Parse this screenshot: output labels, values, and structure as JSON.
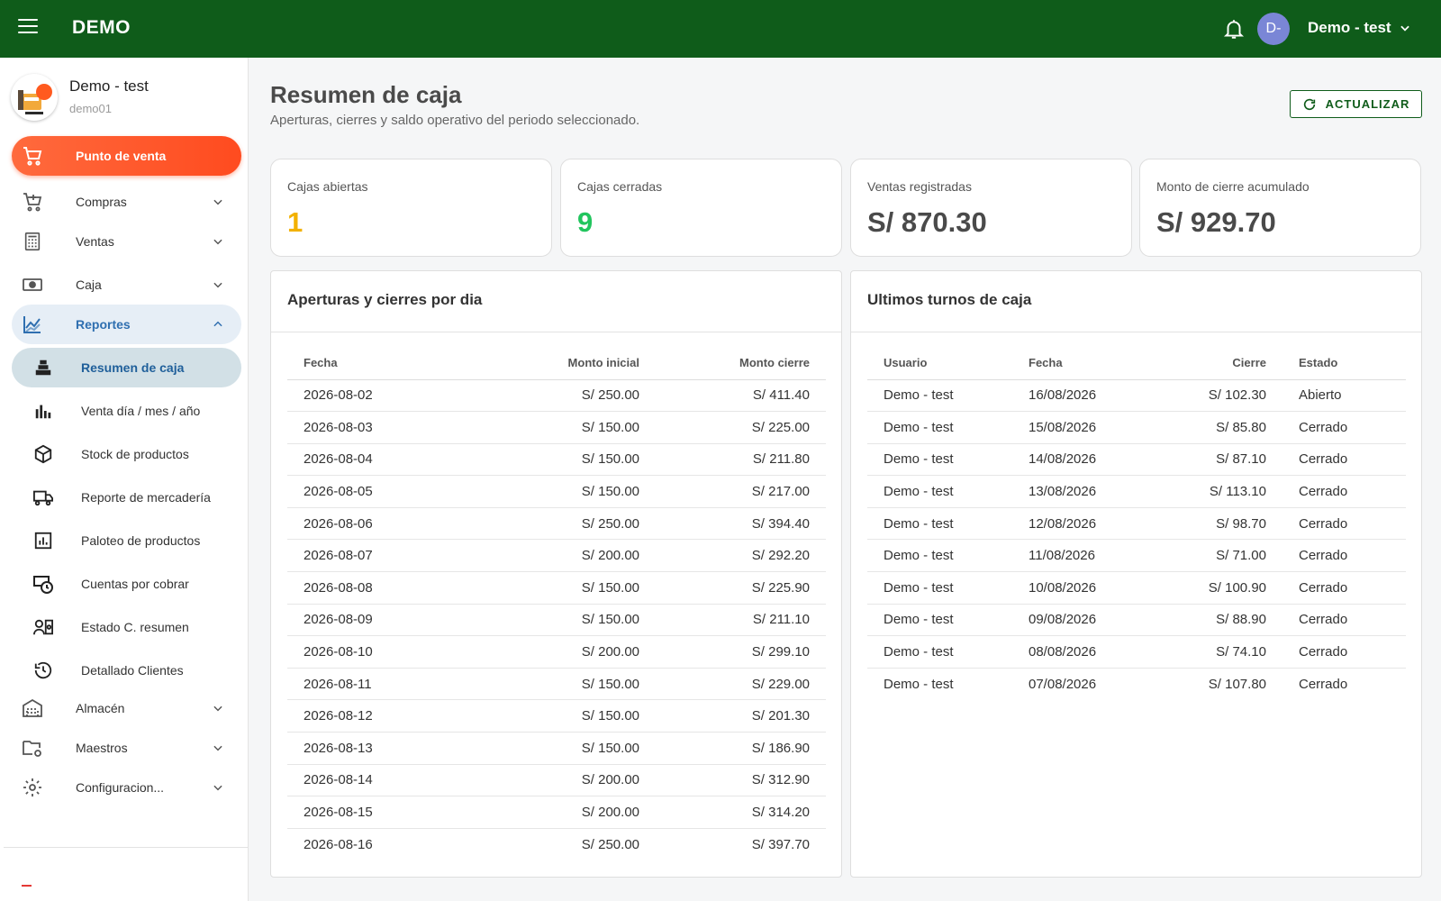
{
  "app": {
    "brand": "DEMO",
    "user_menu": "Demo - test",
    "avatar_initials": "D-"
  },
  "profile": {
    "name": "Demo - test",
    "sub": "demo01"
  },
  "nav": {
    "pos": "Punto de venta",
    "compras": "Compras",
    "ventas": "Ventas",
    "caja": "Caja",
    "reportes": "Reportes",
    "almacen": "Almacén",
    "maestros": "Maestros",
    "config": "Configuracion..."
  },
  "reportes_items": [
    {
      "label": "Resumen de caja",
      "icon": "cash-register-icon"
    },
    {
      "label": "Venta día / mes / año",
      "icon": "bar-chart-icon"
    },
    {
      "label": "Stock de productos",
      "icon": "box-icon"
    },
    {
      "label": "Reporte de mercadería",
      "icon": "truck-icon"
    },
    {
      "label": "Paloteo de productos",
      "icon": "chart-square-icon"
    },
    {
      "label": "Cuentas por cobrar",
      "icon": "money-clock-icon"
    },
    {
      "label": "Estado C. resumen",
      "icon": "user-card-icon"
    },
    {
      "label": "Detallado Clientes",
      "icon": "history-icon"
    }
  ],
  "header": {
    "title": "Resumen de caja",
    "subtitle": "Aperturas, cierres y saldo operativo del periodo seleccionado.",
    "refresh_label": "ACTUALIZAR"
  },
  "stats": [
    {
      "label": "Cajas abiertas",
      "value": "1",
      "color": "#f2b100"
    },
    {
      "label": "Cajas cerradas",
      "value": "9",
      "color": "#22c55e"
    },
    {
      "label": "Ventas registradas",
      "value": "S/ 870.30",
      "color": "#4a4a4a"
    },
    {
      "label": "Monto de cierre acumulado",
      "value": "S/ 929.70",
      "color": "#4a4a4a"
    }
  ],
  "daily": {
    "title": "Aperturas y cierres por dia",
    "columns": [
      "Fecha",
      "Monto inicial",
      "Monto cierre"
    ],
    "rows": [
      [
        "2026-08-02",
        "S/ 250.00",
        "S/ 411.40"
      ],
      [
        "2026-08-03",
        "S/ 150.00",
        "S/ 225.00"
      ],
      [
        "2026-08-04",
        "S/ 150.00",
        "S/ 211.80"
      ],
      [
        "2026-08-05",
        "S/ 150.00",
        "S/ 217.00"
      ],
      [
        "2026-08-06",
        "S/ 250.00",
        "S/ 394.40"
      ],
      [
        "2026-08-07",
        "S/ 200.00",
        "S/ 292.20"
      ],
      [
        "2026-08-08",
        "S/ 150.00",
        "S/ 225.90"
      ],
      [
        "2026-08-09",
        "S/ 150.00",
        "S/ 211.10"
      ],
      [
        "2026-08-10",
        "S/ 200.00",
        "S/ 299.10"
      ],
      [
        "2026-08-11",
        "S/ 150.00",
        "S/ 229.00"
      ],
      [
        "2026-08-12",
        "S/ 150.00",
        "S/ 201.30"
      ],
      [
        "2026-08-13",
        "S/ 150.00",
        "S/ 186.90"
      ],
      [
        "2026-08-14",
        "S/ 200.00",
        "S/ 312.90"
      ],
      [
        "2026-08-15",
        "S/ 200.00",
        "S/ 314.20"
      ],
      [
        "2026-08-16",
        "S/ 250.00",
        "S/ 397.70"
      ]
    ]
  },
  "shifts": {
    "title": "Ultimos turnos de caja",
    "columns": [
      "Usuario",
      "Fecha",
      "Cierre",
      "Estado"
    ],
    "rows": [
      [
        "Demo - test",
        "16/08/2026",
        "S/ 102.30",
        "Abierto"
      ],
      [
        "Demo - test",
        "15/08/2026",
        "S/ 85.80",
        "Cerrado"
      ],
      [
        "Demo - test",
        "14/08/2026",
        "S/ 87.10",
        "Cerrado"
      ],
      [
        "Demo - test",
        "13/08/2026",
        "S/ 113.10",
        "Cerrado"
      ],
      [
        "Demo - test",
        "12/08/2026",
        "S/ 98.70",
        "Cerrado"
      ],
      [
        "Demo - test",
        "11/08/2026",
        "S/ 71.00",
        "Cerrado"
      ],
      [
        "Demo - test",
        "10/08/2026",
        "S/ 100.90",
        "Cerrado"
      ],
      [
        "Demo - test",
        "09/08/2026",
        "S/ 88.90",
        "Cerrado"
      ],
      [
        "Demo - test",
        "08/08/2026",
        "S/ 74.10",
        "Cerrado"
      ],
      [
        "Demo - test",
        "07/08/2026",
        "S/ 107.80",
        "Cerrado"
      ]
    ]
  },
  "colors": {
    "topbar": "#0f5c1a",
    "accent_orange": "#ff5722",
    "active_blue": "#2f6fb0"
  }
}
